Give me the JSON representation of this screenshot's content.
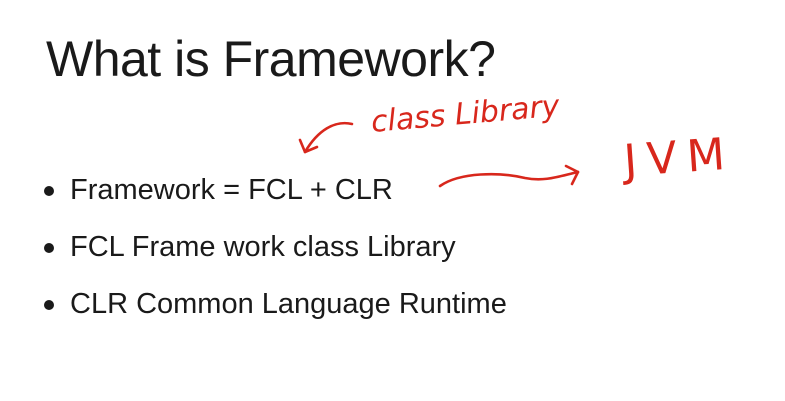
{
  "slide": {
    "title": "What is Framework?",
    "bullets": [
      {
        "text": "Framework = FCL + CLR"
      },
      {
        "text": "FCL Frame work class Library"
      },
      {
        "text": "CLR Common Language Runtime"
      }
    ]
  },
  "annotations": {
    "class_library_note": "class Library",
    "jvm_note": "JVM"
  },
  "colors": {
    "ink": "#d8271c",
    "text": "#1a1a1a",
    "background": "#ffffff"
  }
}
